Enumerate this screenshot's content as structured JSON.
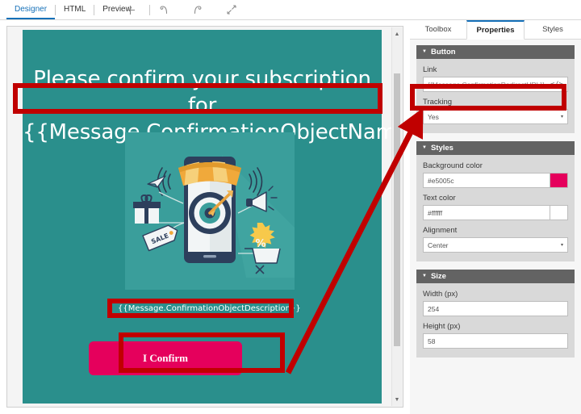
{
  "toolbar": {
    "tabs": [
      {
        "label": "Designer",
        "active": true
      },
      {
        "label": "HTML",
        "active": false
      },
      {
        "label": "Preview",
        "active": false
      }
    ],
    "icons": [
      {
        "name": "plus-icon",
        "glyph": "+"
      },
      {
        "name": "undo-icon",
        "glyph": "↶"
      },
      {
        "name": "redo-icon",
        "glyph": "↷"
      },
      {
        "name": "collapse-icon",
        "glyph": "⤡"
      }
    ]
  },
  "canvas": {
    "background_color": "#2a8f8c",
    "headline_line1": "Please confirm your subscription for",
    "headline_line2": "{{Message.ConfirmationObjectName}}",
    "description": "{{Message.ConfirmationObjectDescription}}",
    "button_label": "I Confirm",
    "button_color": "#e5005c",
    "scrollbar": {
      "up_arrow": "▲",
      "down_arrow": "▼"
    }
  },
  "properties_panel": {
    "tabs": [
      {
        "label": "Toolbox",
        "active": false
      },
      {
        "label": "Properties",
        "active": true
      },
      {
        "label": "Styles",
        "active": false
      }
    ],
    "sections": {
      "button": {
        "title": "Button",
        "link_label": "Link",
        "link_value": "{{Message.ConfirmationRedirectURL}}",
        "link_code_icon": "</>",
        "tracking_label": "Tracking",
        "tracking_value": "Yes",
        "dropdown_arrow": "▾"
      },
      "styles": {
        "title": "Styles",
        "background_color_label": "Background color",
        "background_color_value": "#e5005c",
        "background_color_swatch": "#e5005c",
        "text_color_label": "Text color",
        "text_color_value": "#ffffff",
        "text_color_swatch": "#ffffff",
        "alignment_label": "Alignment",
        "alignment_value": "Center",
        "dropdown_arrow": "▾"
      },
      "size": {
        "title": "Size",
        "width_label": "Width (px)",
        "width_value": "254",
        "height_label": "Height (px)",
        "height_value": "58"
      }
    }
  },
  "annotations": {
    "color": "#c00000",
    "boxes": [
      {
        "name": "headline-highlight"
      },
      {
        "name": "description-highlight"
      },
      {
        "name": "button-highlight"
      },
      {
        "name": "link-field-highlight"
      }
    ],
    "arrow": {
      "name": "callout-arrow",
      "from": "button-highlight",
      "to": "link-field-highlight"
    }
  }
}
